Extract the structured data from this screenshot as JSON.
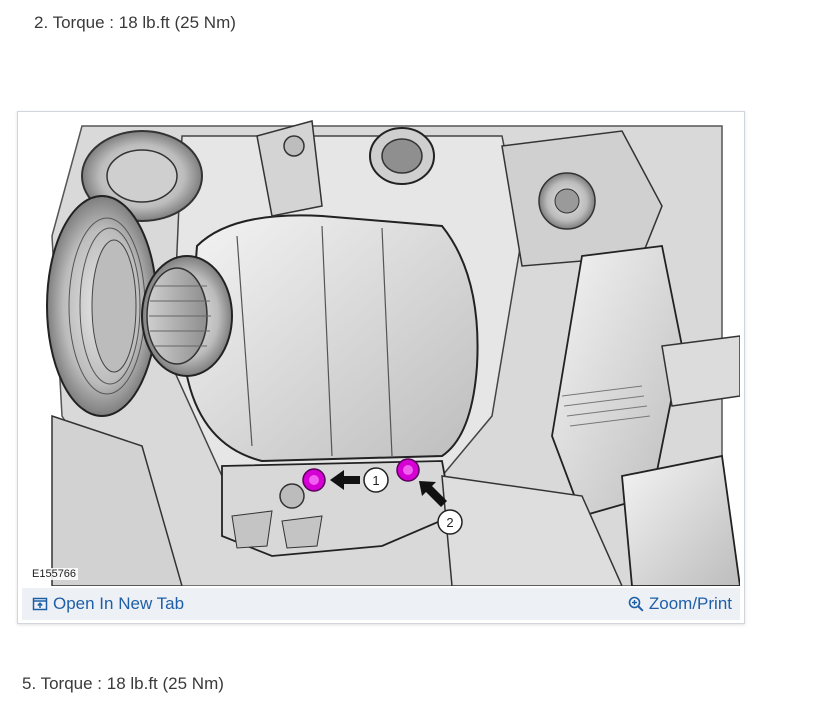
{
  "steps": {
    "top": "2. Torque : 18 lb.ft (25 Nm)",
    "bottom": "5. Torque : 18 lb.ft (25 Nm)"
  },
  "figure": {
    "code": "E155766",
    "callouts": [
      "1",
      "2"
    ],
    "callout_highlight_color": "#d400d4",
    "toolbar": {
      "open_tab_label": "Open In New Tab",
      "open_tab_icon": "open-new-tab-icon",
      "zoom_label": "Zoom/Print",
      "zoom_icon": "zoom-icon"
    }
  },
  "colors": {
    "link": "#1f5fa8",
    "toolbar_bg": "#edf1f5"
  }
}
